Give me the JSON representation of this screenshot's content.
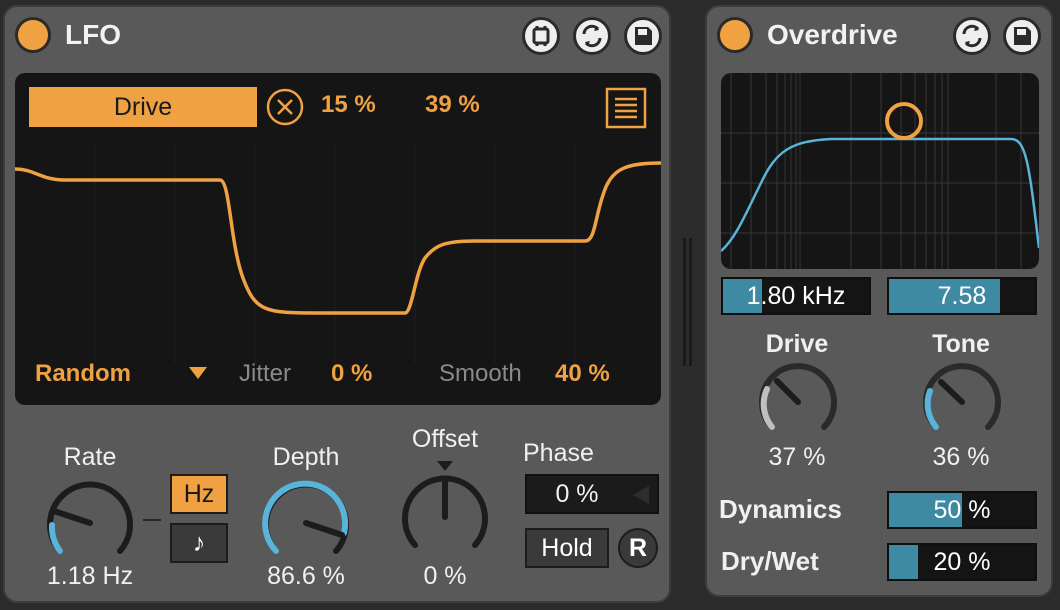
{
  "lfo": {
    "title": "LFO",
    "header_icons": [
      "map-icon",
      "hot-swap-icon",
      "save-icon"
    ],
    "target": {
      "name": "Drive",
      "min": "15 %",
      "max": "39 %"
    },
    "waveform": {
      "shape": "Random",
      "jitter_label": "Jitter",
      "jitter_value": "0 %",
      "smooth_label": "Smooth",
      "smooth_value": "40 %"
    },
    "rate": {
      "label": "Rate",
      "value": "1.18 Hz",
      "unit_hz": "Hz",
      "unit_sync": "♪",
      "level": 0.3
    },
    "depth": {
      "label": "Depth",
      "value": "86.6 %",
      "level": 0.866
    },
    "offset": {
      "label": "Offset",
      "value": "0 %"
    },
    "phase": {
      "label": "Phase",
      "value": "0 %"
    },
    "hold_label": "Hold",
    "retrigger_label": "R"
  },
  "overdrive": {
    "title": "Overdrive",
    "header_icons": [
      "hot-swap-icon",
      "save-icon"
    ],
    "freq": {
      "value": "1.80 kHz",
      "level": 0.27
    },
    "width": {
      "value": "7.58",
      "level": 0.76
    },
    "drive": {
      "label": "Drive",
      "value": "37 %",
      "level": 0.37
    },
    "tone": {
      "label": "Tone",
      "value": "36 %",
      "level": 0.36
    },
    "dynamics": {
      "label": "Dynamics",
      "value": "50 %",
      "level": 0.5
    },
    "drywet": {
      "label": "Dry/Wet",
      "value": "20 %",
      "level": 0.2
    }
  },
  "colors": {
    "accent": "#f0a141",
    "blue": "#3f8aa3",
    "knob_arc": "#5ab4da"
  }
}
